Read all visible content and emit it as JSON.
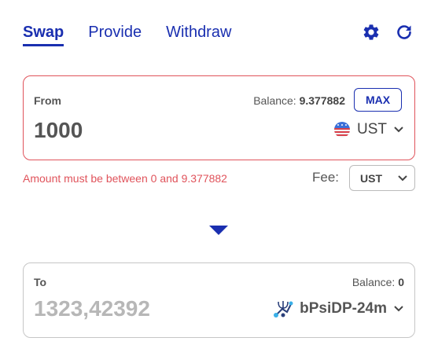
{
  "tabs": [
    {
      "label": "Swap",
      "active": true
    },
    {
      "label": "Provide",
      "active": false
    },
    {
      "label": "Withdraw",
      "active": false
    }
  ],
  "icons": {
    "settings": "gear-icon",
    "refresh": "refresh-icon"
  },
  "colors": {
    "accent": "#1a2fb0",
    "error": "#e0535b"
  },
  "from": {
    "label": "From",
    "balance_label": "Balance:",
    "balance_value": "9.377882",
    "max_label": "MAX",
    "amount": "1000",
    "token": "UST"
  },
  "error_message": "Amount must be between 0 and 9.377882",
  "fee": {
    "label": "Fee:",
    "token": "UST"
  },
  "to": {
    "label": "To",
    "balance_label": "Balance:",
    "balance_value": "0",
    "amount": "1323,42392",
    "token": "bPsiDP-24m"
  }
}
